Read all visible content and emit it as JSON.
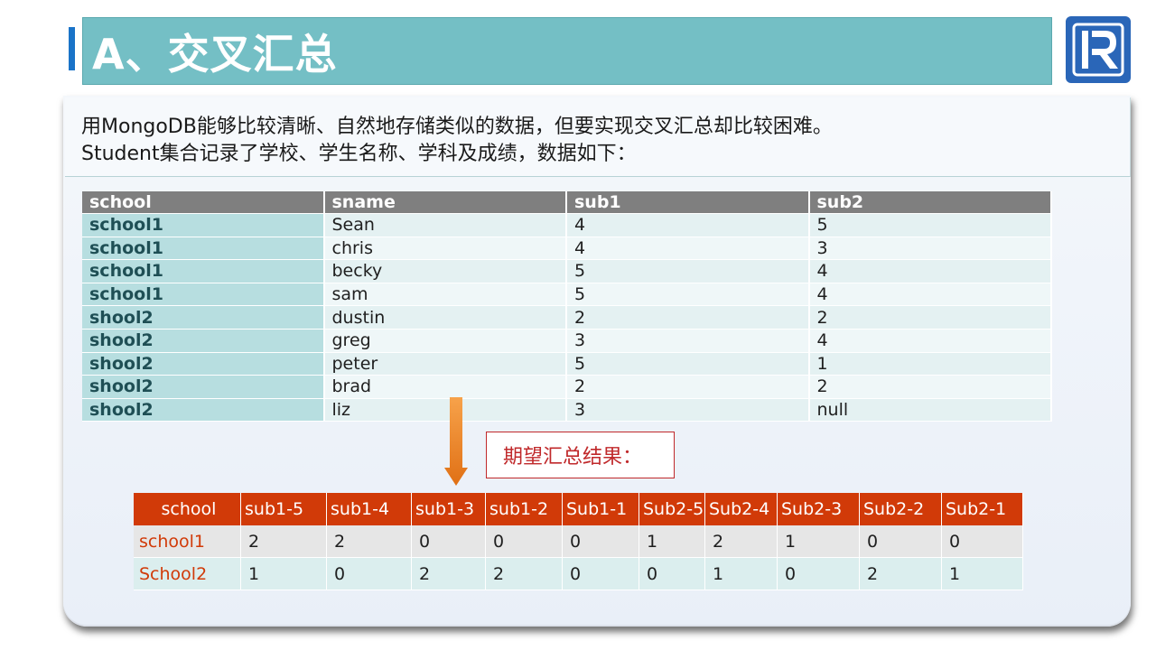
{
  "title": "A、交叉汇总",
  "intro": {
    "line1": "用MongoDB能够比较清晰、自然地存储类似的数据，但要实现交叉汇总却比较困难。",
    "line2": "Student集合记录了学校、学生名称、学科及成绩，数据如下："
  },
  "logo": {
    "icon": "runqian-r-logo",
    "color": "#2a66b8"
  },
  "source_table": {
    "headers": [
      "school",
      "sname",
      "sub1",
      "sub2"
    ],
    "rows": [
      [
        "school1",
        "Sean",
        "4",
        "5"
      ],
      [
        "school1",
        "chris",
        "4",
        "3"
      ],
      [
        "school1",
        "becky",
        "5",
        "4"
      ],
      [
        "school1",
        "sam",
        "5",
        "4"
      ],
      [
        "shool2",
        "dustin",
        "2",
        "2"
      ],
      [
        "shool2",
        "greg",
        "3",
        "4"
      ],
      [
        "shool2",
        "peter",
        "5",
        "1"
      ],
      [
        "shool2",
        "brad",
        "2",
        "2"
      ],
      [
        "shool2",
        "liz",
        "3",
        "null"
      ]
    ]
  },
  "arrow": {
    "icon": "down-arrow-icon",
    "color": "#f08a2a"
  },
  "expect_label": "期望汇总结果：",
  "result_table": {
    "headers": [
      "school",
      "sub1-5",
      "sub1-4",
      "sub1-3",
      "sub1-2",
      "Sub1-1",
      "Sub2-5",
      "Sub2-4",
      "Sub2-3",
      "Sub2-2",
      "Sub2-1"
    ],
    "rows": [
      [
        "school1",
        "2",
        "2",
        "0",
        "0",
        "0",
        "1",
        "2",
        "1",
        "0",
        "0"
      ],
      [
        "School2",
        "1",
        "0",
        "2",
        "2",
        "0",
        "0",
        "1",
        "0",
        "2",
        "1"
      ]
    ]
  },
  "colors": {
    "title_bg": "#74bfc5",
    "accent_blue": "#1a73c8",
    "header_gray": "#7f7f7f",
    "school_teal": "#b7dee0",
    "result_header": "#d13a08",
    "expect_red": "#c0292b"
  }
}
